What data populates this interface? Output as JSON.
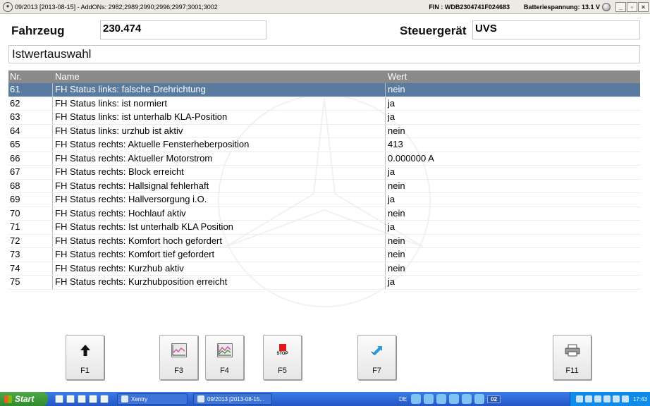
{
  "window": {
    "title": "09/2013 [2013-08-15] - AddONs: 2982;2989;2990;2996;2997;3001;3002",
    "fin": "FIN : WDB2304741F024683",
    "battery": "Batteriespannung: 13.1 V",
    "buttons": {
      "minimize": "_",
      "restore": "▫",
      "close": "×"
    }
  },
  "header": {
    "fahrzeug_label": "Fahrzeug",
    "fahrzeug_value": "230.474",
    "steuergeraet_label": "Steuergerät",
    "steuergeraet_value": "UVS"
  },
  "section": {
    "title": "Istwertauswahl"
  },
  "table": {
    "columns": {
      "nr": "Nr.",
      "name": "Name",
      "wert": "Wert"
    },
    "rows": [
      {
        "nr": "61",
        "name": "FH Status links: falsche Drehrichtung",
        "wert": "nein"
      },
      {
        "nr": "62",
        "name": "FH Status links: ist normiert",
        "wert": "ja"
      },
      {
        "nr": "63",
        "name": "FH Status links: ist unterhalb KLA-Position",
        "wert": "ja"
      },
      {
        "nr": "64",
        "name": "FH Status links: urzhub ist aktiv",
        "wert": "nein"
      },
      {
        "nr": "65",
        "name": "FH Status rechts: Aktuelle Fensterheberposition",
        "wert": "413"
      },
      {
        "nr": "66",
        "name": "FH Status rechts: Aktueller Motorstrom",
        "wert": "0.000000 A"
      },
      {
        "nr": "67",
        "name": "FH Status rechts: Block erreicht",
        "wert": "ja"
      },
      {
        "nr": "68",
        "name": "FH Status rechts: Hallsignal fehlerhaft",
        "wert": "nein"
      },
      {
        "nr": "69",
        "name": "FH Status rechts: Hallversorgung i.O.",
        "wert": "ja"
      },
      {
        "nr": "70",
        "name": "FH Status rechts: Hochlauf aktiv",
        "wert": "nein"
      },
      {
        "nr": "71",
        "name": "FH Status rechts: Ist unterhalb KLA Position",
        "wert": "ja"
      },
      {
        "nr": "72",
        "name": "FH Status rechts: Komfort hoch gefordert",
        "wert": "nein"
      },
      {
        "nr": "73",
        "name": "FH Status rechts: Komfort tief gefordert",
        "wert": "nein"
      },
      {
        "nr": "74",
        "name": "FH Status rechts: Kurzhub aktiv",
        "wert": "nein"
      },
      {
        "nr": "75",
        "name": "FH Status rechts: Kurzhubposition erreicht",
        "wert": "ja"
      }
    ]
  },
  "fkeys": {
    "f1": {
      "label": "F1",
      "icon": "arrow-up-icon"
    },
    "f3": {
      "label": "F3",
      "icon": "graph-icon"
    },
    "f4": {
      "label": "F4",
      "icon": "multi-graph-icon"
    },
    "f5": {
      "label": "F5",
      "icon": "stop-icon",
      "icon_text": "STOP"
    },
    "f7": {
      "label": "F7",
      "icon": "swap-arrows-icon"
    },
    "f11": {
      "label": "F11",
      "icon": "printer-icon"
    }
  },
  "taskbar": {
    "start": "Start",
    "task1": "Xentry",
    "task2": "09/2013 [2013-08-15...",
    "lang": "DE",
    "badge": "02",
    "clock": "17:43"
  },
  "colors": {
    "selected_row": "#5a7ba0",
    "table_header": "#8a8a8a",
    "taskbar": "#2456c4",
    "start_button": "#3a9a36"
  }
}
